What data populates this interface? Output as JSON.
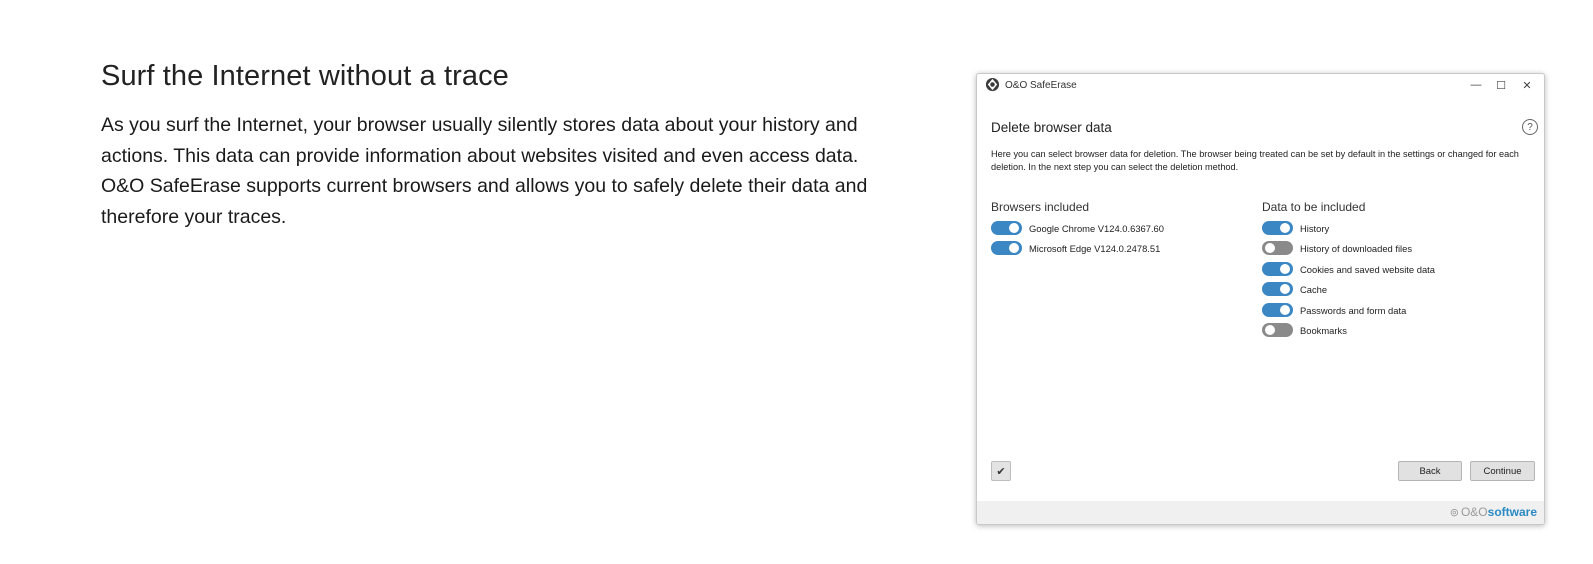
{
  "intro": {
    "title": "Surf the Internet without a trace",
    "paragraph": "As you surf the Internet, your browser usually silently stores data about your history and actions. This data can provide information about websites visited and even access data. O&O SafeErase supports current browsers and allows you to safely delete their data and therefore your traces."
  },
  "window": {
    "title": "O&O SafeErase",
    "minimize_glyph": "—",
    "maximize_glyph": "☐",
    "close_glyph": "✕",
    "heading": "Delete browser data",
    "help_glyph": "?",
    "description": "Here you can select browser data for deletion. The browser being treated can be set by default in the settings or changed for each deletion. In the next step you can select the deletion method.",
    "browsers": {
      "title": "Browsers included",
      "items": [
        {
          "label": "Google Chrome V124.0.6367.60",
          "on": true
        },
        {
          "label": "Microsoft Edge V124.0.2478.51",
          "on": true
        }
      ]
    },
    "data": {
      "title": "Data to be included",
      "items": [
        {
          "label": "History",
          "on": true
        },
        {
          "label": "History of downloaded files",
          "on": false
        },
        {
          "label": "Cookies and saved website data",
          "on": true
        },
        {
          "label": "Cache",
          "on": true
        },
        {
          "label": "Passwords and form data",
          "on": true
        },
        {
          "label": "Bookmarks",
          "on": false
        }
      ]
    },
    "check_glyph": "✔",
    "back_label": "Back",
    "continue_label": "Continue",
    "brand": {
      "mark": "⊚",
      "oo": "O&O",
      "software": "software"
    }
  },
  "colors": {
    "toggle_on": "#3a87c4",
    "toggle_off": "#8a8a8a",
    "brand_blue": "#2a8ac4"
  }
}
